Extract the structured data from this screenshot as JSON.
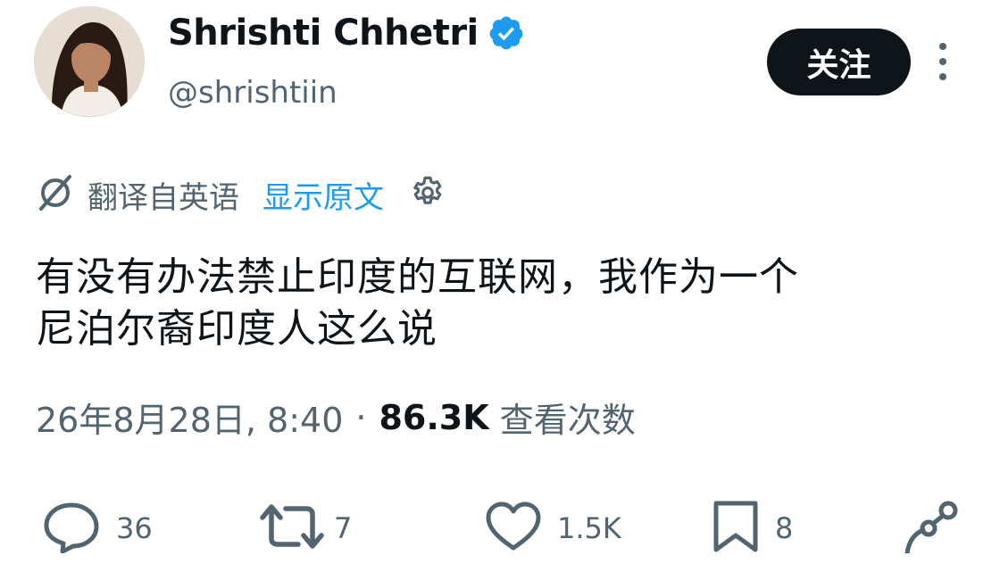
{
  "author": {
    "name": "Shrishti Chhetri",
    "handle": "@shrishtiin",
    "verified_color": "#1d9bf0"
  },
  "follow_button": {
    "label": "关注"
  },
  "translation": {
    "label": "翻译自英语",
    "show_original": "显示原文"
  },
  "tweet": {
    "text": "有没有办法禁止印度的互联网，我作为一个\n尼泊尔裔印度人这么说"
  },
  "meta": {
    "timestamp": "26年8月28日, 8:40",
    "separator": "·",
    "views_count": "86.3K",
    "views_label": "查看次数"
  },
  "actions": {
    "replies": "36",
    "retweets": "7",
    "likes": "1.5K",
    "bookmarks": "8"
  },
  "colors": {
    "accent": "#1d9bf0",
    "text": "#0f1419",
    "muted": "#536471"
  }
}
